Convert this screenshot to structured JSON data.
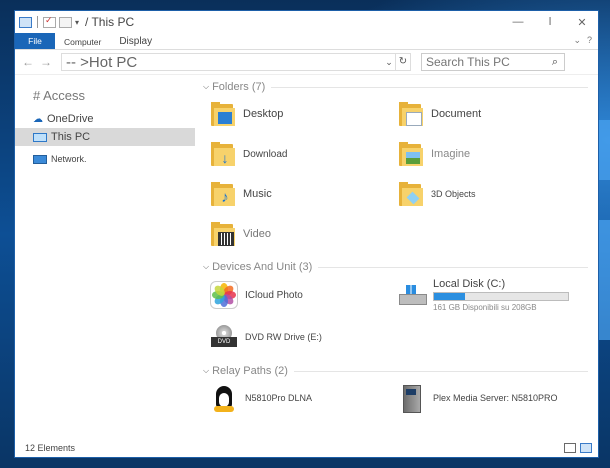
{
  "window": {
    "title": "/ This PC",
    "controls": {
      "minimize": "—",
      "maximize": "ǀ",
      "close": "✕"
    }
  },
  "ribbon": {
    "file_label": "File",
    "tabs": [
      "Computer",
      "Display"
    ],
    "help": "?",
    "collapse": "⌄"
  },
  "address": {
    "back": "←",
    "forward": "→",
    "path": "-- >Hot PC",
    "search_placeholder": "Search This PC"
  },
  "sidebar": {
    "items": [
      {
        "label": "# Access",
        "icon": "star-icon"
      },
      {
        "label": "OneDrive",
        "icon": "onedrive-icon"
      },
      {
        "label": "This PC",
        "icon": "computer-icon",
        "selected": true
      },
      {
        "label": "Network.",
        "icon": "network-icon"
      }
    ]
  },
  "groups": {
    "folders": {
      "title": "Folders (7)",
      "items": [
        "Desktop",
        "Document",
        "Download",
        "Imagine",
        "Music",
        "3D Objects",
        "Video"
      ]
    },
    "devices": {
      "title": "Devices And Unit (3)",
      "icloud": "ICloud Photo",
      "local_disk": {
        "label": "Local Disk (C:)",
        "sub": "161 GB Disponibili su 208GB",
        "used_fraction": 0.23
      },
      "dvd": "DVD RW Drive (E:)",
      "dvd_tag": "DVD"
    },
    "network": {
      "title": "Relay Paths (2)",
      "items": [
        "N5810Pro DLNA",
        "Plex Media Server: N5810PRO"
      ]
    }
  },
  "status": {
    "count": "12 Elements"
  },
  "colors": {
    "accent": "#1a66b8",
    "folder": "#f7d26b",
    "disk_fill": "#2b8fe0"
  }
}
